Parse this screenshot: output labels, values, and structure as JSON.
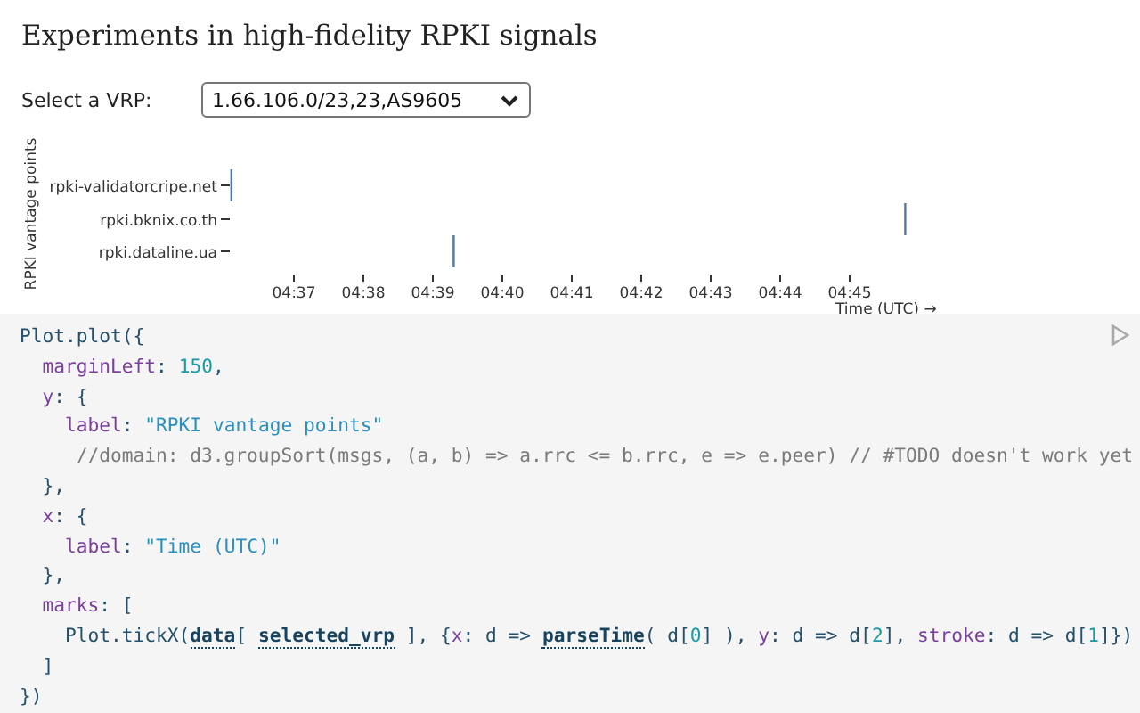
{
  "title": "Experiments in high-fidelity RPKI signals",
  "vrp_select": {
    "label": "Select a VRP:",
    "value": "1.66.106.0/23,23,AS9605"
  },
  "chart": {
    "y_axis_label": "RPKI vantage points",
    "row_labels": [
      "rpki-validatorcripe.net",
      "rpki.bknix.co.th",
      "rpki.dataline.ua"
    ],
    "time_labels": [
      "04:37",
      "04:38",
      "04:39",
      "04:40",
      "04:41",
      "04:42",
      "04:43",
      "04:44",
      "04:45"
    ],
    "x_axis_label": "Time (UTC) →"
  },
  "code": {
    "lines": [
      [
        {
          "kind": "plain",
          "text": "Plot.plot({"
        }
      ],
      [
        {
          "kind": "prop",
          "text": "  marginLeft"
        },
        {
          "kind": "plain",
          "text": ": "
        },
        {
          "kind": "num",
          "text": "150"
        },
        {
          "kind": "plain",
          "text": ","
        }
      ],
      [
        {
          "kind": "prop",
          "text": "  y"
        },
        {
          "kind": "plain",
          "text": ": {"
        }
      ],
      [
        {
          "kind": "prop",
          "text": "    label"
        },
        {
          "kind": "plain",
          "text": ": "
        },
        {
          "kind": "str",
          "text": "\"RPKI vantage points\""
        }
      ],
      [
        {
          "kind": "comment",
          "text": "     //domain: d3.groupSort(msgs, (a, b) => a.rrc <= b.rrc, e => e.peer) // #TODO doesn't work yet"
        }
      ],
      [
        {
          "kind": "plain",
          "text": "  },"
        }
      ],
      [
        {
          "kind": "prop",
          "text": "  x"
        },
        {
          "kind": "plain",
          "text": ": {"
        }
      ],
      [
        {
          "kind": "prop",
          "text": "    label"
        },
        {
          "kind": "plain",
          "text": ": "
        },
        {
          "kind": "str",
          "text": "\"Time (UTC)\""
        }
      ],
      [
        {
          "kind": "plain",
          "text": "  },"
        }
      ],
      [
        {
          "kind": "prop",
          "text": "  marks"
        },
        {
          "kind": "plain",
          "text": ": ["
        }
      ],
      [
        {
          "kind": "plain",
          "text": "    Plot.tickX("
        },
        {
          "kind": "ref",
          "text": "data"
        },
        {
          "kind": "plain",
          "text": "[ "
        },
        {
          "kind": "ref",
          "text": "selected_vrp"
        },
        {
          "kind": "plain",
          "text": " ], {"
        },
        {
          "kind": "prop",
          "text": "x"
        },
        {
          "kind": "plain",
          "text": ": d => "
        },
        {
          "kind": "ref",
          "text": "parseTime"
        },
        {
          "kind": "plain",
          "text": "( d["
        },
        {
          "kind": "num",
          "text": "0"
        },
        {
          "kind": "plain",
          "text": "] ), "
        },
        {
          "kind": "prop",
          "text": "y"
        },
        {
          "kind": "plain",
          "text": ": d => d["
        },
        {
          "kind": "num",
          "text": "2"
        },
        {
          "kind": "plain",
          "text": "], "
        },
        {
          "kind": "prop",
          "text": "stroke"
        },
        {
          "kind": "plain",
          "text": ": d => d["
        },
        {
          "kind": "num",
          "text": "1"
        },
        {
          "kind": "plain",
          "text": "]})"
        }
      ],
      [
        {
          "kind": "plain",
          "text": "  ]"
        }
      ],
      [
        {
          "kind": "plain",
          "text": "})"
        }
      ]
    ]
  }
}
